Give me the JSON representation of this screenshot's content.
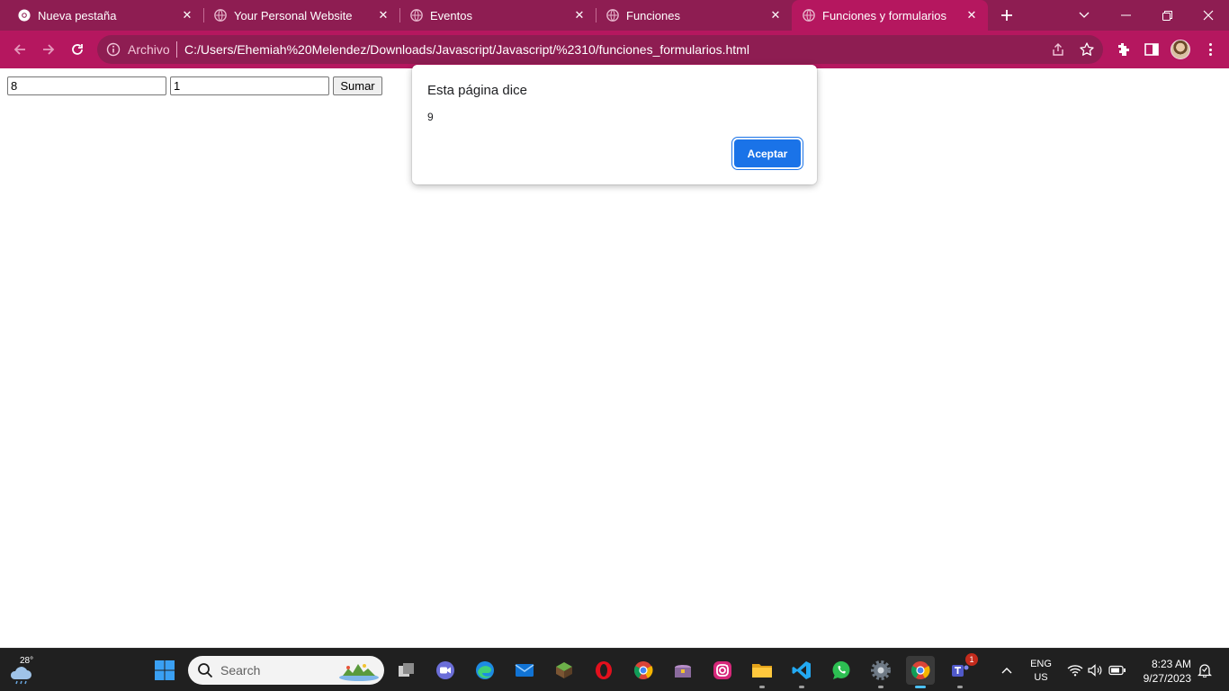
{
  "browser": {
    "tabs": [
      {
        "title": "Nueva pestaña",
        "active": false
      },
      {
        "title": "Your Personal Website",
        "active": false
      },
      {
        "title": "Eventos",
        "active": false
      },
      {
        "title": "Funciones",
        "active": false
      },
      {
        "title": "Funciones y formularios",
        "active": true
      }
    ],
    "theme_colors": {
      "frame": "#8e1d52",
      "toolbar": "#b5175f"
    },
    "omnibox": {
      "chip": "Archivo",
      "url": "C:/Users/Ehemiah%20Melendez/Downloads/Javascript/Javascript/%2310/funciones_formularios.html"
    }
  },
  "page": {
    "input_a": "8",
    "input_b": "1",
    "sumar_label": "Sumar"
  },
  "dialog": {
    "title": "Esta página dice",
    "message": "9",
    "ok_label": "Aceptar",
    "ok_color": "#1a73e8"
  },
  "taskbar": {
    "weather_temp": "28°",
    "search_label": "Search",
    "teams_badge": "1",
    "lang_line1": "ENG",
    "lang_line2": "US",
    "time": "8:23 AM",
    "date": "9/27/2023"
  }
}
